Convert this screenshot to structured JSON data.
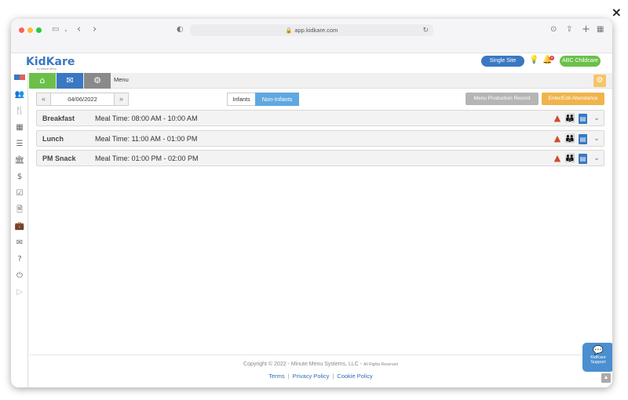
{
  "overlay": {
    "close_icon": "×"
  },
  "browser": {
    "url": "app.kidkare.com",
    "icons": {
      "sidebar": "sidebar-icon",
      "back": "‹",
      "forward": "›",
      "shield": "shield-icon",
      "download": "⊙",
      "share": "⇪",
      "new_tab": "+",
      "tabs": "▦",
      "reload": "↻",
      "lock": "🔒"
    }
  },
  "app": {
    "logo_text": "KidKare",
    "logo_sub": "by Minute Menu",
    "single_site_label": "Single Site",
    "notification_count": "9",
    "org_label": "ABC Childcare"
  },
  "nav": {
    "breadcrumb": "Menu",
    "home_icon": "⌂",
    "mail_icon": "✉",
    "settings_icon": "⚙"
  },
  "toolbar": {
    "date": "04/06/2022",
    "prev": "«",
    "next": "»",
    "infants_label": "Infants",
    "non_infants_label": "Non-Infants",
    "menu_production_label": "Menu Production Record",
    "attendance_label": "Enter/Edit Attendance"
  },
  "meals": [
    {
      "name": "Breakfast",
      "time": "Meal Time: 08:00 AM - 10:00 AM"
    },
    {
      "name": "Lunch",
      "time": "Meal Time: 11:00 AM - 01:00 PM"
    },
    {
      "name": "PM Snack",
      "time": "Meal Time: 01:00 PM - 02:00 PM"
    }
  ],
  "footer": {
    "copyright": "Copyright © 2022 - Minute Menu Systems, LLC -",
    "rights": "All Rights Reserved",
    "terms": "Terms",
    "privacy": "Privacy Policy",
    "cookie": "Cookie Policy"
  },
  "support": {
    "label": "KidKare Support"
  },
  "colors": {
    "brand_blue": "#3a78c3",
    "green": "#6cc04a",
    "orange": "#f0b44c",
    "gray_btn": "#b5b5b5"
  }
}
